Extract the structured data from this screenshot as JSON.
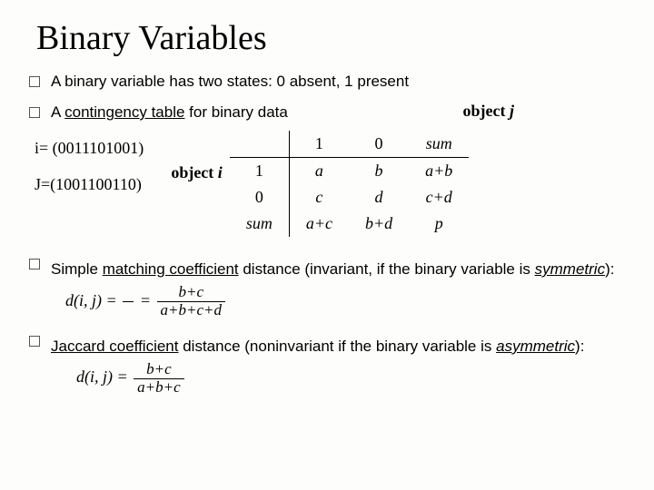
{
  "title": "Binary Variables",
  "bullets": {
    "b1": "A binary variable has two states: 0 absent, 1 present",
    "b2_pre": "A ",
    "b2_u": "contingency table",
    "b2_post": " for binary data",
    "b3_pre": "Simple ",
    "b3_u1": "matching coefficient",
    "b3_mid": " distance (invariant, if the binary variable is ",
    "b3_u2": "symmetric",
    "b3_post": "):",
    "b4_pre": "Jaccard coefficient",
    "b4_mid": " distance (noninvariant if the binary variable is ",
    "b4_u": "asymmetric",
    "b4_post": "):"
  },
  "examples": {
    "i": "i= (0011101001)",
    "j": "J=(1001100110)"
  },
  "labels": {
    "object_i_pre": "object ",
    "object_i_it": "i",
    "object_j_pre": "object ",
    "object_j_it": "j"
  },
  "table": {
    "h1": "1",
    "h0": "0",
    "hsum": "sum",
    "r1": "1",
    "a": "a",
    "b": "b",
    "ab": "a+b",
    "r0": "0",
    "c": "c",
    "d": "d",
    "cd": "c+d",
    "rsum": "sum",
    "ac": "a+c",
    "bd": "b+d",
    "p": "p"
  },
  "formulas": {
    "dij": "d(i, j) = ",
    "eqsp": " = ",
    "smc_num": "b+c",
    "smc_den": "a+b+c+d",
    "jac_num": "b+c",
    "jac_den": "a+b+c"
  }
}
